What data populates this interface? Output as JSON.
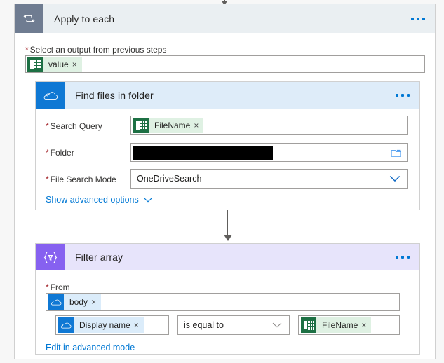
{
  "outer_action": {
    "title": "Apply to each",
    "icon": "loop-arrow-icon",
    "menu": "more-commands",
    "field": {
      "label": "Select an output from previous steps",
      "required": true,
      "token": {
        "text": "value",
        "icon": "excel-icon",
        "remove": "×"
      }
    }
  },
  "actions": [
    {
      "id": "find-files-in-folder",
      "title": "Find files in folder",
      "icon": "onedrive-icon",
      "menu": "more-commands",
      "fields": [
        {
          "label": "Search Query",
          "required": true,
          "type": "token",
          "token": {
            "text": "FileName",
            "icon": "excel-icon",
            "remove": "×"
          }
        },
        {
          "label": "Folder",
          "required": true,
          "type": "redacted",
          "value": "",
          "trailing_icon": "folder-picker-icon"
        },
        {
          "label": "File Search Mode",
          "required": true,
          "type": "dropdown",
          "value": "OneDriveSearch",
          "trailing_icon": "chevron-down-icon"
        }
      ],
      "advanced_link": {
        "label": "Show advanced options",
        "icon": "chevron-down-icon"
      }
    },
    {
      "id": "filter-array",
      "title": "Filter array",
      "icon": "filter-braces-icon",
      "menu": "more-commands",
      "fields": [
        {
          "label": "From",
          "required": true,
          "type": "token",
          "token": {
            "text": "body",
            "icon": "onedrive-icon",
            "remove": "×"
          }
        }
      ],
      "condition": {
        "left": {
          "text": "Display name",
          "icon": "onedrive-icon",
          "remove": "×"
        },
        "operator": {
          "value": "is equal to",
          "trailing_icon": "chevron-down-icon"
        },
        "right": {
          "text": "FileName",
          "icon": "excel-icon",
          "remove": "×"
        }
      },
      "advanced_link": {
        "label": "Edit in advanced mode"
      }
    }
  ],
  "colors": {
    "apply_to_each_icon_bg": "#6f7c91",
    "apply_to_each_header_bg": "#eaeff2",
    "onedrive_blue": "#0f78d4",
    "onedrive_header_bg": "#deecf9",
    "filter_purple": "#8661f0",
    "filter_header_bg": "#e7e4fb",
    "excel_green": "#1d7044",
    "token_green_bg": "#dff1e3",
    "token_blue_bg": "#dbecfa",
    "link_blue": "#0078d4",
    "required_red": "#a4262c",
    "connector_gray": "#605e5c"
  }
}
